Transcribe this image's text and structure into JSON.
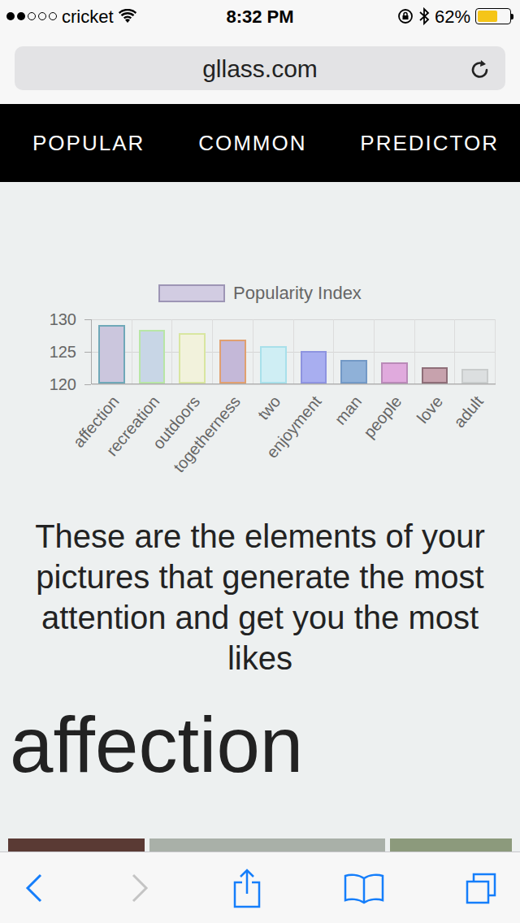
{
  "status_bar": {
    "signal_level": 0.4,
    "carrier": "cricket",
    "time": "8:32 PM",
    "battery": "62%",
    "battery_level": 0.62
  },
  "address_bar": {
    "url": "gllass.com"
  },
  "nav": [
    {
      "label": "POPULAR"
    },
    {
      "label": "COMMON"
    },
    {
      "label": "PREDICTOR"
    }
  ],
  "chart": {
    "legend": "Popularity Index",
    "ticks": [
      "130",
      "125",
      "120"
    ],
    "bars": [
      {
        "label": "affection",
        "value": 129,
        "color": "#cbc6dd",
        "border": "#6fa8b8"
      },
      {
        "label": "recreation",
        "value": 128.3,
        "color": "#c8d6e6",
        "border": "#b8e6a6"
      },
      {
        "label": "outdoors",
        "value": 127.8,
        "color": "#f2f2dc",
        "border": "#d8e6a0"
      },
      {
        "label": "togetherness",
        "value": 126.7,
        "color": "#c4b8d8",
        "border": "#e0a070"
      },
      {
        "label": "two",
        "value": 125.7,
        "color": "#cfeef4",
        "border": "#a8e0ea"
      },
      {
        "label": "enjoyment",
        "value": 125,
        "color": "#a8aef0",
        "border": "#8e94e0"
      },
      {
        "label": "man",
        "value": 123.6,
        "color": "#8fb1d8",
        "border": "#7399c6"
      },
      {
        "label": "people",
        "value": 123.2,
        "color": "#e0aadd",
        "border": "#b98ab8"
      },
      {
        "label": "love",
        "value": 122.5,
        "color": "#c7a2ad",
        "border": "#8e6e78"
      },
      {
        "label": "adult",
        "value": 122.3,
        "color": "#dcdfe0",
        "border": "#c9cccc"
      }
    ]
  },
  "caption": "These are the elements of your pictures that generate the most attention and get you the most likes",
  "section_title": "affection",
  "toolbar": {
    "back_enabled": true,
    "forward_enabled": false
  }
}
